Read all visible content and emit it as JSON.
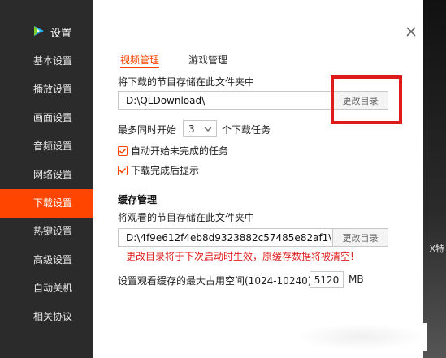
{
  "app": {
    "title": "设置"
  },
  "sidebar": {
    "items": [
      {
        "label": "基本设置",
        "active": false
      },
      {
        "label": "播放设置",
        "active": false
      },
      {
        "label": "画面设置",
        "active": false
      },
      {
        "label": "音频设置",
        "active": false
      },
      {
        "label": "网络设置",
        "active": false
      },
      {
        "label": "下载设置",
        "active": true
      },
      {
        "label": "热键设置",
        "active": false
      },
      {
        "label": "高级设置",
        "active": false
      },
      {
        "label": "自动关机",
        "active": false
      },
      {
        "label": "相关协议",
        "active": false
      }
    ]
  },
  "tabs": [
    {
      "label": "视频管理",
      "active": true
    },
    {
      "label": "游戏管理",
      "active": false
    }
  ],
  "download": {
    "folder_label": "将下载的节目存储在此文件夹中",
    "folder_path": "D:\\QLDownload\\",
    "change_button": "更改目录",
    "max_prefix": "最多同时开始",
    "max_value": "3",
    "max_suffix": "个下载任务",
    "auto_start_label": "自动开始未完成的任务",
    "auto_start_checked": true,
    "notify_label": "下载完成后提示",
    "notify_checked": true
  },
  "cache": {
    "section_title": "缓存管理",
    "folder_label": "将观看的节目存储在此文件夹中",
    "folder_path": "D:\\4f9e612f4eb8d9323882c57485e82af1\\",
    "change_button": "更改目录",
    "warning": "更改目录将于下次启动时生效，原缓存数据将被清空!",
    "max_size_label": "设置观看缓存的最大占用空间(1024-10240)",
    "max_size_value": "5120",
    "max_size_unit": "MB"
  },
  "background": {
    "edge_text": "X特"
  },
  "colors": {
    "accent": "#ff4500",
    "sidebar_bg": "#2b2b2b",
    "warning": "#e02020",
    "highlight": "#e01a1a"
  },
  "icons": {
    "logo": "tencent-video-logo-icon",
    "close": "close-icon",
    "select": "chevron-down-icon",
    "check": "check-icon"
  }
}
